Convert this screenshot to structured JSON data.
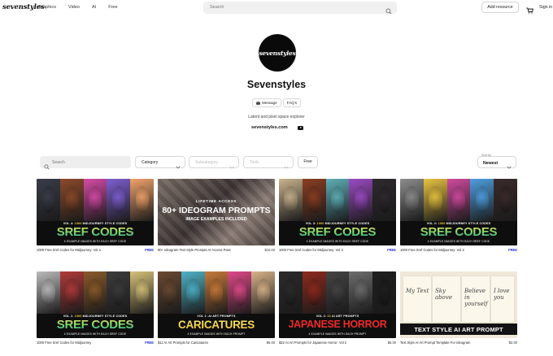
{
  "nav": {
    "logo": "sevenstyles",
    "links": [
      "Graphics",
      "Video",
      "AI",
      "Free"
    ],
    "search_placeholder": "Search",
    "add_resource": "Add resource",
    "sign_in": "Sign in"
  },
  "profile": {
    "avatar_text": "sevenstyles",
    "name": "Sevenstyles",
    "message_btn": "Message",
    "faq_btn": "FAQ's",
    "tagline": "Latent and pixel space explorer",
    "website": "sevenstyles.com"
  },
  "filters": {
    "search_placeholder": "Search",
    "category": "Category",
    "subcategory": "Subcategory",
    "tools": "Tools",
    "free": "Free",
    "sort_label": "Sort by",
    "sort_value": "Newest"
  },
  "products": [
    {
      "title": "1000 Free Sref Codes for Midjourney: Vol 4",
      "price": "FREE",
      "banner_sub_a": "VOL 4",
      "banner_sub_b": "1000",
      "banner_sub_c": "MIDJOURNEY STYLE CODES",
      "banner_big": "SREF CODES",
      "banner_small": "4 EXAMPLE IMAGES WITH EACH SREF CODE",
      "colors": [
        "#3a3d48",
        "#8c4a2a",
        "#d64aa6",
        "#7e5fd1",
        "#f0a36b"
      ]
    },
    {
      "title": "80+ Ideogram Text Style Prompts AI Access Pass",
      "price": "$10.00",
      "banner_l1": "LIFETIME ACCESS",
      "banner_l2": "80+ IDEOGRAM PROMPTS",
      "banner_l3": "IMAGE EXAMPLES INCLUDED"
    },
    {
      "title": "1000 Free Sref Codes for Midjourney: Vol 3",
      "price": "FREE",
      "banner_sub_a": "VOL 3",
      "banner_sub_b": "1000",
      "banner_sub_c": "MIDJOURNEY STYLE CODES",
      "banner_big": "SREF CODES",
      "banner_small": "4 EXAMPLE IMAGES WITH EACH SREF CODE",
      "colors": [
        "#c9b38e",
        "#8b3e22",
        "#5fb0b8",
        "#9b4bc4",
        "#2e2a2f"
      ]
    },
    {
      "title": "1000 Free Sref Codes for Midjourney: Vol 2",
      "price": "FREE",
      "banner_sub_a": "VOL 2",
      "banner_sub_b": "1000",
      "banner_sub_c": "MIDJOURNEY STYLE CODES",
      "banner_big": "SREF CODES",
      "banner_small": "4 EXAMPLE IMAGES WITH EACH SREF CODE",
      "colors": [
        "#8d8d8d",
        "#e9c440",
        "#d14ba0",
        "#4f9fe0",
        "#3a2a2a"
      ]
    },
    {
      "title": "1000 Free Sref Codes for Midjourney",
      "price": "FREE",
      "banner_sub_a": "VOL 1",
      "banner_sub_b": "1000",
      "banner_sub_c": "MIDJOURNEY STYLE CODES",
      "banner_big": "SREF CODES",
      "banner_small": "4 EXAMPLE IMAGES WITH EACH SREF CODE",
      "colors": [
        "#bcbcbc",
        "#b03a3a",
        "#8a5a2a",
        "#3c3c3c",
        "#d7c27a"
      ]
    },
    {
      "title": "$11 AI Art Prompts for Caricatures",
      "price": "$6.00",
      "banner_sub_a": "VOL 1",
      "banner_sub_b": "",
      "banner_sub_c": "AI ART PROMPTS",
      "banner_big": "CARICATURES",
      "banner_small": "4 EXAMPLE IMAGES WITH EACH PROMPT",
      "colors": [
        "#6b4a32",
        "#4fb3c9",
        "#c87a3a",
        "#e04a8a",
        "#d9b38a"
      ]
    },
    {
      "title": "$22 AI Art Prompts for Japanese Horror: Vol 2",
      "price": "$5.00",
      "banner_sub_a": "VOL 2",
      "banner_sub_b": "22",
      "banner_sub_c": "AI ART PROMPTS",
      "banner_big": "JAPANESE HORROR",
      "banner_small": "4 EXAMPLE IMAGES WITH EACH PROMPT",
      "colors": [
        "#2b2b2b",
        "#8e2a1e",
        "#444444",
        "#6d6d6d",
        "#1e1e1e"
      ]
    },
    {
      "title": "Text Style AI Art Prompt Template For Ideogram",
      "price": "$2.00",
      "banner_big": "TEXT STYLE AI ART PROMPT",
      "panels": [
        "My Text",
        "Sky above",
        "Believe in yourself",
        "I love you"
      ]
    }
  ]
}
